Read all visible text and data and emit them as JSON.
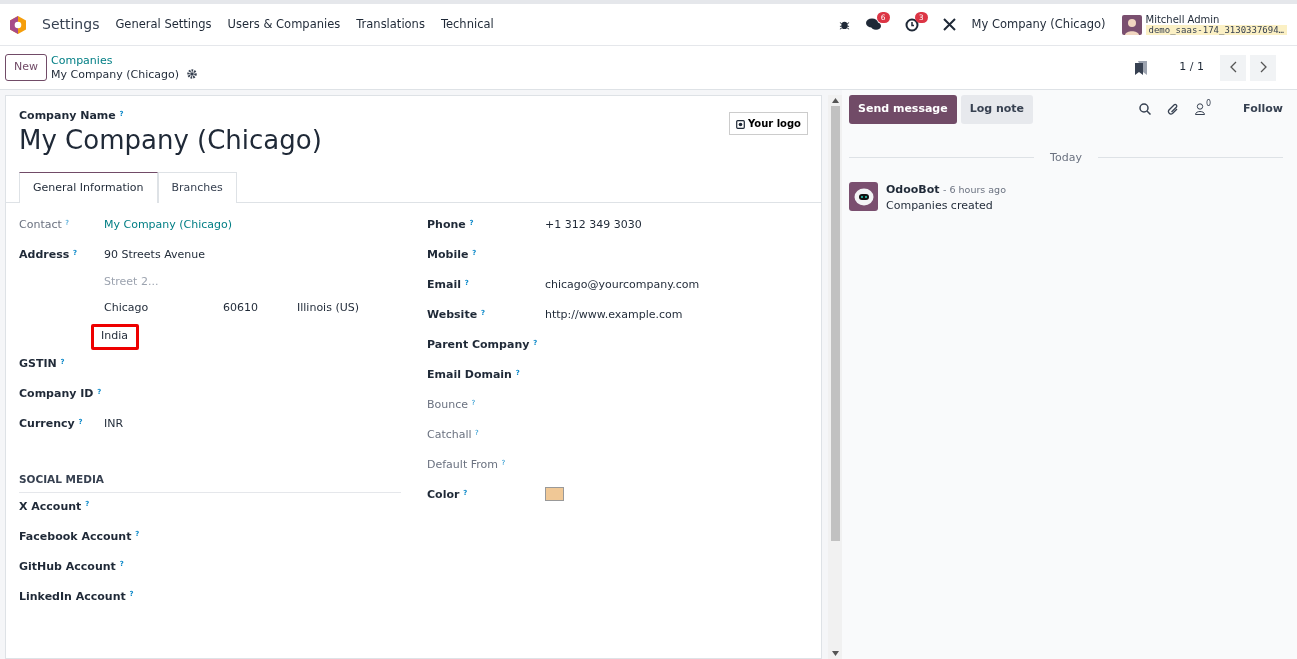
{
  "navbar": {
    "app": "Settings",
    "menus": [
      "General Settings",
      "Users & Companies",
      "Translations",
      "Technical"
    ],
    "messages_count": "6",
    "activities_count": "3",
    "company": "My Company (Chicago)",
    "user": "Mitchell Admin",
    "database": "demo_saas-174_3130337694…"
  },
  "control_panel": {
    "new_button": "New",
    "breadcrumb": "Companies",
    "record": "My Company (Chicago)",
    "pager": "1 / 1"
  },
  "form": {
    "name_label": "Company Name $^{?}$",
    "name": "My Company (Chicago)",
    "logo_button": "Your logo",
    "tabs": [
      {
        "label": "General Information",
        "selected": true
      },
      {
        "label": "Branches",
        "selected": false
      }
    ],
    "left_fields": [
      {
        "label": "Contact $^{?}$",
        "kind": "muted",
        "value": "My Company (Chicago)",
        "link": true
      },
      {
        "label": "Address $^{?}$",
        "kind": "strong",
        "address": {
          "street": "90 Streets Avenue",
          "street2_placeholder": "Street 2...",
          "city": "Chicago",
          "zip": "60610",
          "state": "Illinois (US)",
          "country": "India",
          "country_highlighted": true
        }
      },
      {
        "label": "GSTIN $^{?}$",
        "kind": "strong"
      },
      {
        "label": "Company ID $^{?}$",
        "kind": "strong"
      },
      {
        "label": "Currency $^{?}$",
        "kind": "strong",
        "value": "INR"
      }
    ],
    "right_fields": [
      {
        "label": "Phone $^{?}$",
        "kind": "strong",
        "value": "+1 312 349 3030"
      },
      {
        "label": "Mobile $^{?}$",
        "kind": "strong"
      },
      {
        "label": "Email $^{?}$",
        "kind": "strong",
        "value": "chicago@yourcompany.com"
      },
      {
        "label": "Website $^{?}$",
        "kind": "strong",
        "value": "http://www.example.com"
      },
      {
        "label": "Parent Company $^{?}$",
        "kind": "strong"
      },
      {
        "label": "Email Domain $^{?}$",
        "kind": "strong"
      },
      {
        "label": "Bounce $^{?}$",
        "kind": "muted"
      },
      {
        "label": "Catchall $^{?}$",
        "kind": "muted"
      },
      {
        "label": "Default From $^{?}$",
        "kind": "muted"
      },
      {
        "label": "Color $^{?}$",
        "kind": "strong",
        "color": "#f0c896"
      }
    ],
    "social_heading": "SOCIAL MEDIA",
    "social_fields": [
      "X Account $^{?}$",
      "Facebook Account $^{?}$",
      "GitHub Account $^{?}$",
      "LinkedIn Account $^{?}$"
    ]
  },
  "chatter": {
    "send_button": "Send message",
    "log_button": "Log note",
    "followers_count": "0",
    "follow": "Follow",
    "date_separator": "Today",
    "messages": [
      {
        "author": "OdooBot",
        "time": "- 6 hours ago",
        "body": "Companies created"
      }
    ]
  }
}
